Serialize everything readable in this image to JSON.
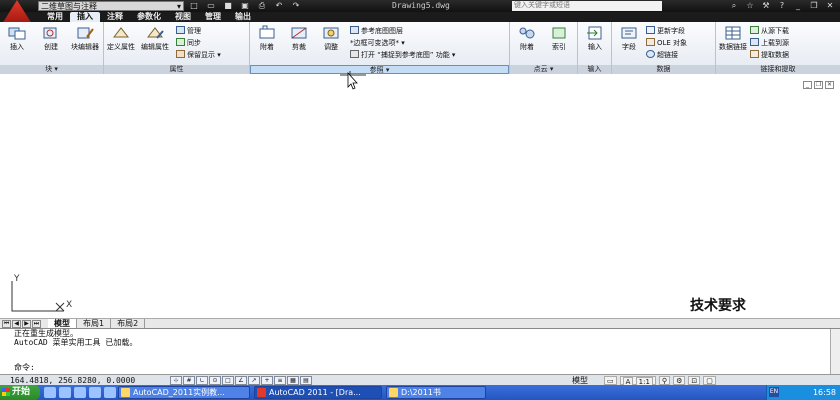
{
  "titlebar": {
    "workspace": "二维草图与注释",
    "doc_title": "Drawing5.dwg",
    "search_placeholder": "键入关键字或短语"
  },
  "tabs": [
    "常用",
    "插入",
    "注释",
    "参数化",
    "视图",
    "管理",
    "输出"
  ],
  "active_tab": "插入",
  "ribbon": {
    "block_panel": {
      "title": "块",
      "buttons": [
        "插入",
        "创建",
        "块编辑器"
      ]
    },
    "attr_panel": {
      "title": "属性",
      "big_buttons": [
        "定义属性",
        "编辑属性"
      ],
      "small_buttons": [
        "管理",
        "同步",
        "保留显示"
      ]
    },
    "ref_panel": {
      "title": "参照",
      "big_buttons": [
        "附着",
        "剪裁",
        "调整"
      ],
      "small_buttons": [
        "参考底图图层",
        "*边框可变选项*",
        "打开 “捕捉到参考底图” 功能"
      ]
    },
    "cloud_panel": {
      "title": "点云",
      "buttons": [
        "附着",
        "索引"
      ]
    },
    "import_panel": {
      "title": "输入",
      "buttons": [
        "输入"
      ]
    },
    "data_panel": {
      "title": "数据",
      "big_buttons": [
        "字段"
      ],
      "small_buttons": [
        "更新字段",
        "OLE 对象",
        "超链接"
      ]
    },
    "link_panel": {
      "title": "链接和提取",
      "big_buttons": [
        "数据链接"
      ],
      "small_buttons": [
        "从源下载",
        "上载到源",
        "提取数据"
      ]
    }
  },
  "drawing": {
    "text": "技术要求",
    "ucs_x": "X",
    "ucs_y": "Y"
  },
  "layout_tabs": [
    "模型",
    "布局1",
    "布局2"
  ],
  "command": {
    "lines": [
      "正在重生成模型。",
      "AutoCAD 菜单实用工具 已加载。"
    ],
    "prompt": "命令:"
  },
  "status": {
    "coords": "164.4818, 256.8280, 0.0000",
    "model": "模型",
    "scale": "1:1"
  },
  "taskbar": {
    "start": "开始",
    "buttons": [
      "AutoCAD_2011实例教...",
      "AutoCAD 2011 - [Dra...",
      "D:\\2011书"
    ],
    "clock": "16:58",
    "lang": "EN"
  }
}
